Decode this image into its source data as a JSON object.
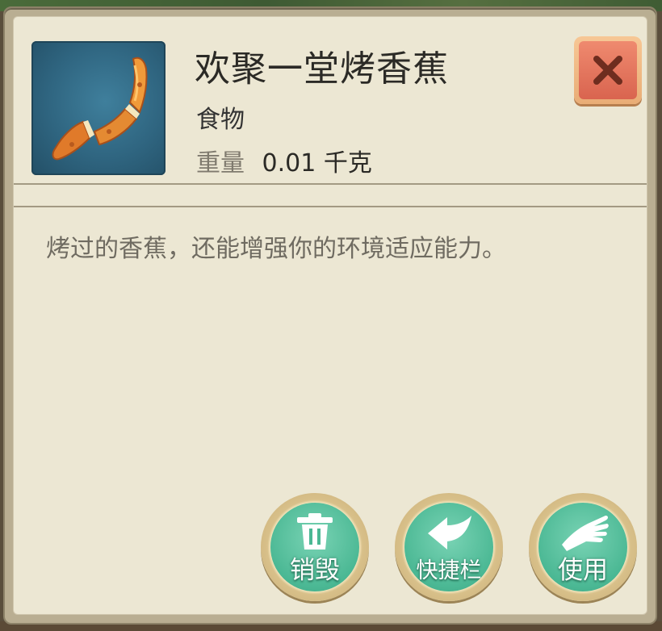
{
  "item": {
    "name": "欢聚一堂烤香蕉",
    "category": "食物",
    "weight_label": "重量",
    "weight_value": "0.01 千克",
    "description": "烤过的香蕉，还能增强你的环境适应能力。",
    "icon": "roasted-banana-icon"
  },
  "actions": {
    "destroy_label": "销毁",
    "quickbar_label": "快捷栏",
    "use_label": "使用"
  },
  "colors": {
    "panel_bg": "#ece7d3",
    "action_green": "#4bb894",
    "close_red": "#d9644f"
  }
}
